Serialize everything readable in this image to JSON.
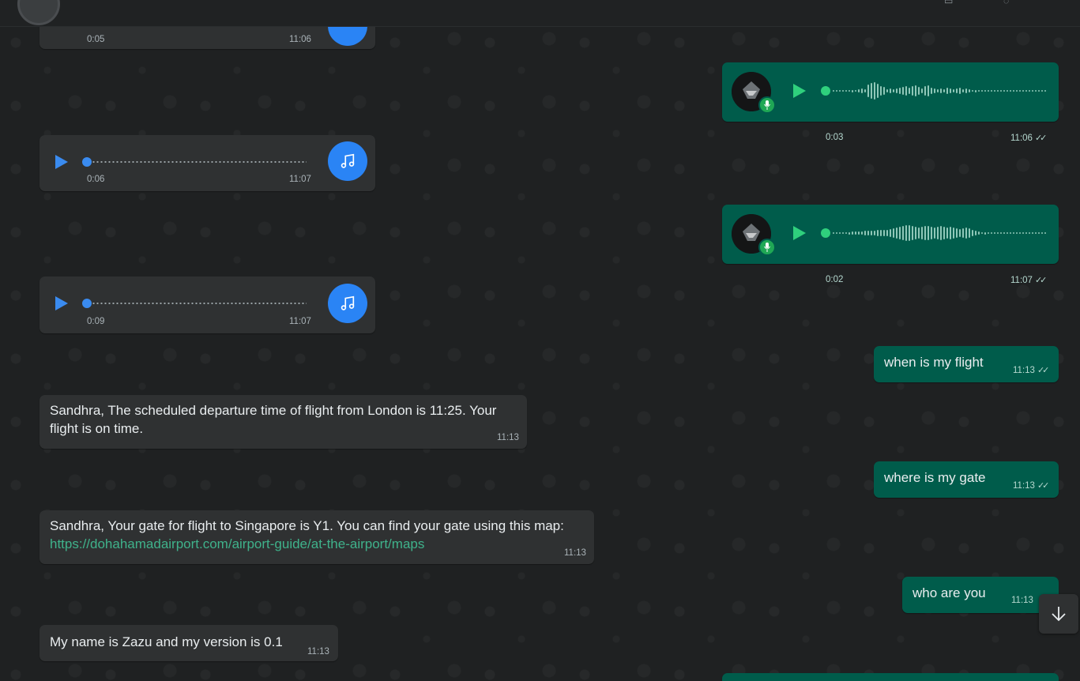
{
  "messages": {
    "v1": {
      "duration": "0:05",
      "time": "11:06"
    },
    "o1": {
      "duration": "0:03",
      "time": "11:06"
    },
    "v2": {
      "duration": "0:06",
      "time": "11:07"
    },
    "o2": {
      "duration": "0:02",
      "time": "11:07"
    },
    "v3": {
      "duration": "0:09",
      "time": "11:07"
    },
    "q1": {
      "text": "when is my flight",
      "time": "11:13"
    },
    "a1": {
      "text": "Sandhra, The scheduled departure time of flight from London is 11:25. Your flight is on time.",
      "time": "11:13"
    },
    "q2": {
      "text": "where is my gate",
      "time": "11:13"
    },
    "a2": {
      "text": "Sandhra, Your gate for flight to Singapore is Y1. You can find your gate using this map:",
      "link": "https://dohahamadairport.com/airport-guide/at-the-airport/maps",
      "time": "11:13"
    },
    "q3": {
      "text": "who are you",
      "time": "11:13"
    },
    "a3": {
      "text": "My name is Zazu and my version is 0.1",
      "time": "11:13"
    }
  },
  "icons": {
    "play_in": "play-icon",
    "play_out": "play-icon",
    "music": "music-note-icon",
    "mic": "microphone-icon",
    "read": "double-check-icon",
    "scroll": "arrow-down-icon"
  },
  "colors": {
    "incoming_bubble": "#2f3132",
    "outgoing_bubble": "#005c4b",
    "accent_blue": "#2a84f5",
    "accent_green": "#2fd07d",
    "link": "#3fb28b"
  }
}
